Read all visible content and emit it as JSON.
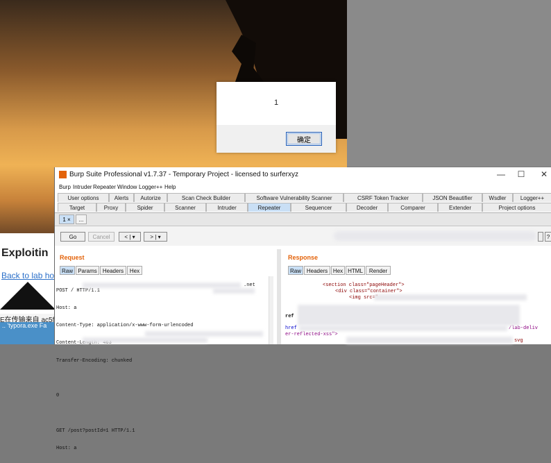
{
  "background_page": {
    "heading": "Exploitin",
    "back_link": "Back to lab ho",
    "notice": "E在传输来自 ac5f1f",
    "taskbar_text": "..  'typora.exe  Fa"
  },
  "alert": {
    "message": "1",
    "ok_label": "确定"
  },
  "burp": {
    "title": "Burp Suite Professional v1.7.37 - Temporary Project - licensed to surferxyz",
    "window_controls": {
      "minimize": "—",
      "maximize": "☐",
      "close": "✕"
    },
    "menu": [
      "Burp",
      "Intruder",
      "Repeater",
      "Window",
      "Logger++",
      "Help"
    ],
    "tabs_row1": [
      "User options",
      "Alerts",
      "Autorize",
      "Scan Check Builder",
      "Software Vulnerability Scanner",
      "CSRF Token Tracker",
      "JSON Beautifier",
      "Wsdler",
      "Logger++"
    ],
    "tabs_row2": [
      "Target",
      "Proxy",
      "Spider",
      "Scanner",
      "Intruder",
      "Repeater",
      "Sequencer",
      "Decoder",
      "Comparer",
      "Extender",
      "Project options"
    ],
    "active_tab": "Repeater",
    "repeater_tabs": [
      "1 ×",
      "..."
    ],
    "toolbar": {
      "go": "Go",
      "cancel": "Cancel",
      "back": "< | ▾",
      "forward": "> | ▾",
      "help": "?"
    },
    "request": {
      "heading": "Request",
      "tabs": [
        "Raw",
        "Params",
        "Headers",
        "Hex"
      ],
      "lines": [
        "POST / HTTP/1.1",
        "Host: a",
        "Content-Type: application/x-www-form-urlencoded",
        "Content-Length: 463",
        "Transfer-Encoding: chunked",
        "",
        "0",
        "",
        "GET /post?postId=1 HTTP/1.1",
        "Host: a"
      ],
      "host_tail": ".net"
    },
    "response": {
      "heading": "Response",
      "tabs": [
        "Raw",
        "Headers",
        "Hex",
        "HTML",
        "Render"
      ],
      "line1": "<section class=\"pageHeader\">",
      "line2": "<div class=\"container\">",
      "line3": "<img src=\"",
      "line4": "ref",
      "line5a": "href",
      "line5b": "/lab-deliv",
      "line6": "er-reflected-xss\">",
      "line7": "svg"
    }
  }
}
